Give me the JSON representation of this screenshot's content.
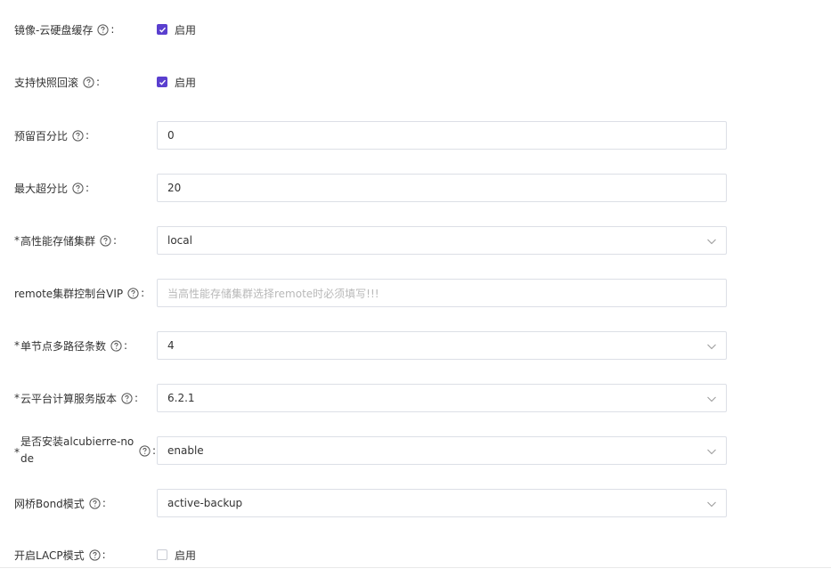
{
  "form": {
    "fields": [
      {
        "key": "image_cache",
        "label": "镜像-云硬盘缓存",
        "required": false,
        "type": "checkbox",
        "checked": true,
        "check_label": "启用"
      },
      {
        "key": "snapshot_rollback",
        "label": "支持快照回滚",
        "required": false,
        "type": "checkbox",
        "checked": true,
        "check_label": "启用"
      },
      {
        "key": "reserved_percent",
        "label": "预留百分比",
        "required": false,
        "type": "input",
        "value": "0"
      },
      {
        "key": "max_over_ratio",
        "label": "最大超分比",
        "required": false,
        "type": "input",
        "value": "20"
      },
      {
        "key": "hp_cluster",
        "label": "高性能存储集群",
        "required": true,
        "type": "select",
        "value": "local"
      },
      {
        "key": "remote_vip",
        "label": "remote集群控制台VIP",
        "required": false,
        "type": "input",
        "value": "",
        "placeholder": "当高性能存储集群选择remote时必须填写!!!"
      },
      {
        "key": "multipath_count",
        "label": "单节点多路径条数",
        "required": true,
        "type": "select",
        "value": "4"
      },
      {
        "key": "compute_version",
        "label": "云平台计算服务版本",
        "required": true,
        "type": "select",
        "value": "6.2.1"
      },
      {
        "key": "alcubierre_node",
        "label": "是否安装alcubierre-node",
        "required": true,
        "type": "select",
        "value": "enable"
      },
      {
        "key": "bridge_bond",
        "label": "网桥Bond模式",
        "required": false,
        "type": "select",
        "value": "active-backup"
      },
      {
        "key": "lacp_mode",
        "label": "开启LACP模式",
        "required": false,
        "type": "checkbox",
        "checked": false,
        "check_label": "启用"
      }
    ],
    "colon": ":",
    "required_mark": "*"
  },
  "icons": {
    "help": "question-circle-icon",
    "chevron": "chevron-down-icon",
    "check": "check-icon"
  },
  "colors": {
    "accent": "#5a3fcf",
    "border": "#dcdfe6",
    "placeholder": "#b8b8b8",
    "text": "#333333"
  }
}
